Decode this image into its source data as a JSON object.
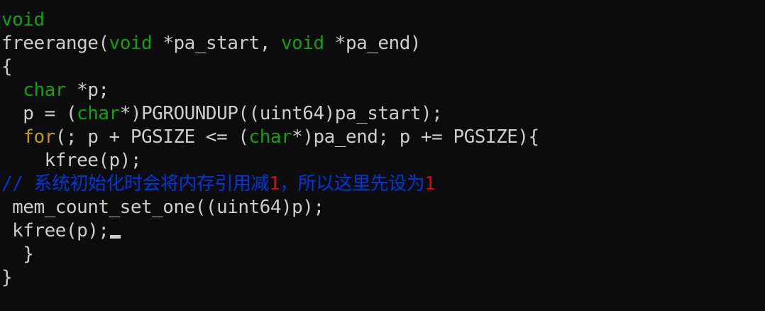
{
  "colors": {
    "background": "#0c0c0c",
    "text": "#cccccc",
    "keyword_green": "#13a10e",
    "keyword_orange": "#c19c00",
    "comment_blue": "#0037da",
    "number_red": "#c50f1f"
  },
  "code_lines": [
    [
      {
        "t": "void",
        "c": "keyword_green"
      }
    ],
    [
      {
        "t": "freerange(",
        "c": "text"
      },
      {
        "t": "void",
        "c": "keyword_green"
      },
      {
        "t": " *pa_start, ",
        "c": "text"
      },
      {
        "t": "void",
        "c": "keyword_green"
      },
      {
        "t": " *pa_end)",
        "c": "text"
      }
    ],
    [
      {
        "t": "{",
        "c": "text"
      }
    ],
    [
      {
        "t": "  ",
        "c": "text"
      },
      {
        "t": "char",
        "c": "keyword_green"
      },
      {
        "t": " *p;",
        "c": "text"
      }
    ],
    [
      {
        "t": "  p = (",
        "c": "text"
      },
      {
        "t": "char",
        "c": "keyword_green"
      },
      {
        "t": "*)PGROUNDUP((uint64)pa_start);",
        "c": "text"
      }
    ],
    [
      {
        "t": "  ",
        "c": "text"
      },
      {
        "t": "for",
        "c": "keyword_orange"
      },
      {
        "t": "(; p + PGSIZE <= (",
        "c": "text"
      },
      {
        "t": "char",
        "c": "keyword_green"
      },
      {
        "t": "*)pa_end; p += PGSIZE){",
        "c": "text"
      }
    ],
    [
      {
        "t": "    kfree(p);",
        "c": "text"
      }
    ],
    [
      {
        "t": "// 系统初始化时会将内存引用减",
        "c": "comment_blue"
      },
      {
        "t": "1",
        "c": "number_red"
      },
      {
        "t": "，所以这里先设为",
        "c": "comment_blue"
      },
      {
        "t": "1",
        "c": "number_red"
      }
    ],
    [
      {
        "t": " mem_count_set_one((uint64)p);",
        "c": "text"
      }
    ],
    [
      {
        "t": " kfree(p);",
        "c": "text"
      }
    ],
    [
      {
        "t": "  }",
        "c": "text"
      }
    ],
    [
      {
        "t": "}",
        "c": "text"
      }
    ]
  ],
  "cursor": {
    "line": 9
  }
}
